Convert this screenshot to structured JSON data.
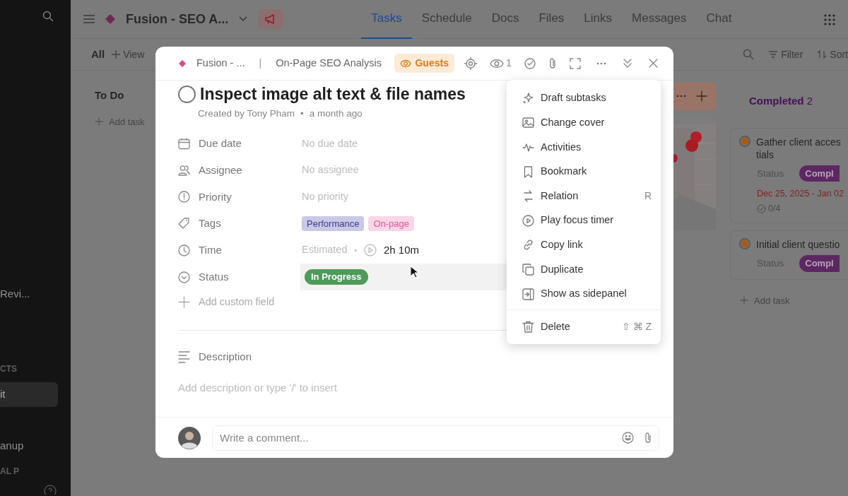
{
  "sidebar": {
    "items": [
      {
        "kind": "item",
        "label": "Revi...",
        "selected": false
      },
      {
        "kind": "heading",
        "label": "CTS"
      },
      {
        "kind": "item",
        "label": "it",
        "selected": true
      },
      {
        "kind": "item",
        "label": "anup",
        "selected": false
      },
      {
        "kind": "heading",
        "label": "AL P"
      }
    ]
  },
  "top_bar": {
    "title": "Fusion - SEO A...",
    "tabs": [
      {
        "label": "Tasks",
        "selected": true
      },
      {
        "label": "Schedule",
        "selected": false
      },
      {
        "label": "Docs",
        "selected": false
      },
      {
        "label": "Files",
        "selected": false
      },
      {
        "label": "Links",
        "selected": false
      },
      {
        "label": "Messages",
        "selected": false
      },
      {
        "label": "Chat",
        "selected": false
      }
    ]
  },
  "toolbar": {
    "view": "All",
    "add_view": "View",
    "filter": "Filter",
    "sort": "Sort"
  },
  "board": {
    "columns": [
      {
        "kind": "list",
        "title": "To Do",
        "add_task": "Add task"
      },
      {
        "kind": "cover"
      },
      {
        "kind": "list",
        "title": "Completed",
        "count": "2",
        "add_task": "Add task",
        "cards": [
          {
            "title_lines": [
              "Gather client acces",
              "tials"
            ],
            "status_label": "Status",
            "status": "Compl",
            "date": "Dec 25, 2025 - Jan 02",
            "subtasks": "0/4"
          },
          {
            "title_lines": [
              "Initial client questio"
            ],
            "status_label": "Status",
            "status": "Compl"
          }
        ]
      }
    ]
  },
  "modal": {
    "breadcrumb": [
      "Fusion - ...",
      "On-Page SEO Analysis"
    ],
    "breadcrumb_separator": "|",
    "guests": "Guests",
    "watchers": "1",
    "title": "Inspect image alt text & file names",
    "completed": false,
    "created_by": "Created by Tony Pham",
    "created_separator": "•",
    "created_when": "a month ago",
    "fields": [
      {
        "kind": "text",
        "label": "Due date",
        "placeholder": "No due date",
        "hovered": false
      },
      {
        "kind": "text",
        "label": "Assignee",
        "placeholder": "No assignee",
        "hovered": false
      },
      {
        "kind": "text",
        "label": "Priority",
        "placeholder": "No priority",
        "hovered": false
      },
      {
        "kind": "tags",
        "label": "Tags",
        "hovered": false,
        "tags": [
          {
            "label": "Performance",
            "color": "#c9c8e6"
          },
          {
            "label": "On-page",
            "color": "#fbd6e8"
          }
        ]
      },
      {
        "kind": "time",
        "label": "Time",
        "estimate_label": "Estimated",
        "separator": "•",
        "value": "2h 10m",
        "hovered": false
      },
      {
        "kind": "status",
        "label": "Status",
        "value": "In Progress",
        "color": "#4e9a5b",
        "hovered": true
      }
    ],
    "add_field": "Add custom field",
    "description_label": "Description",
    "description_placeholder": "Add description or type '/' to insert",
    "comment_placeholder": "Write a comment..."
  },
  "menu": {
    "items": [
      {
        "label": "Draft subtasks"
      },
      {
        "label": "Change cover"
      },
      {
        "label": "Activities"
      },
      {
        "label": "Bookmark"
      },
      {
        "label": "Relation",
        "shortcut": "R"
      },
      {
        "label": "Play focus timer"
      },
      {
        "label": "Copy link"
      },
      {
        "label": "Duplicate"
      },
      {
        "label": "Show as sidepanel"
      }
    ],
    "footer_items": [
      {
        "label": "Delete",
        "shortcut": "⇧ ⌘ Z"
      }
    ]
  }
}
